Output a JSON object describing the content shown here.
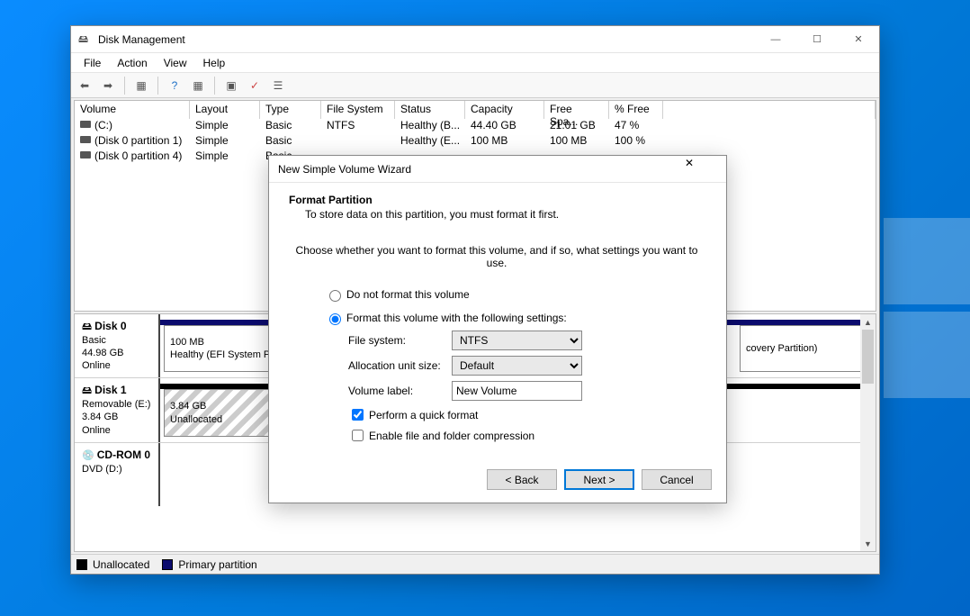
{
  "win": {
    "title": "Disk Management",
    "menu": {
      "file": "File",
      "action": "Action",
      "view": "View",
      "help": "Help"
    },
    "headers": [
      "Volume",
      "Layout",
      "Type",
      "File System",
      "Status",
      "Capacity",
      "Free Spa...",
      "% Free"
    ],
    "rows": [
      {
        "vol": "(C:)",
        "layout": "Simple",
        "type": "Basic",
        "fs": "NTFS",
        "status": "Healthy (B...",
        "cap": "44.40 GB",
        "free": "21.01 GB",
        "pct": "47 %"
      },
      {
        "vol": "(Disk 0 partition 1)",
        "layout": "Simple",
        "type": "Basic",
        "fs": "",
        "status": "Healthy (E...",
        "cap": "100 MB",
        "free": "100 MB",
        "pct": "100 %"
      },
      {
        "vol": "(Disk 0 partition 4)",
        "layout": "Simple",
        "type": "Basic",
        "fs": "",
        "status": "",
        "cap": "",
        "free": "",
        "pct": ""
      }
    ],
    "disks": [
      {
        "name": "Disk 0",
        "type": "Basic",
        "size": "44.98 GB",
        "state": "Online",
        "parts": [
          {
            "line1": "100 MB",
            "line2": "Healthy (EFI System P",
            "width": 135
          },
          {
            "line1": "",
            "line2": "covery Partition)",
            "width": 0
          }
        ]
      },
      {
        "name": "Disk 1",
        "type": "Removable (E:)",
        "size": "3.84 GB",
        "state": "Online",
        "parts": [
          {
            "line1": "3.84 GB",
            "line2": "Unallocated",
            "width": 135,
            "hatched": true
          }
        ]
      },
      {
        "name": "CD-ROM 0",
        "type": "DVD (D:)",
        "size": "",
        "state": ""
      }
    ],
    "legend": {
      "a": "Unallocated",
      "b": "Primary partition"
    }
  },
  "dlg": {
    "title": "New Simple Volume Wizard",
    "heading": "Format Partition",
    "sub": "To store data on this partition, you must format it first.",
    "prompt": "Choose whether you want to format this volume, and if so, what settings you want to use.",
    "radio1": "Do not format this volume",
    "radio2": "Format this volume with the following settings:",
    "fs_label": "File system:",
    "fs_value": "NTFS",
    "au_label": "Allocation unit size:",
    "au_value": "Default",
    "vl_label": "Volume label:",
    "vl_value": "New Volume",
    "chk_quick": "Perform a quick format",
    "chk_compress": "Enable file and folder compression",
    "back": "< Back",
    "next": "Next >",
    "cancel": "Cancel"
  }
}
